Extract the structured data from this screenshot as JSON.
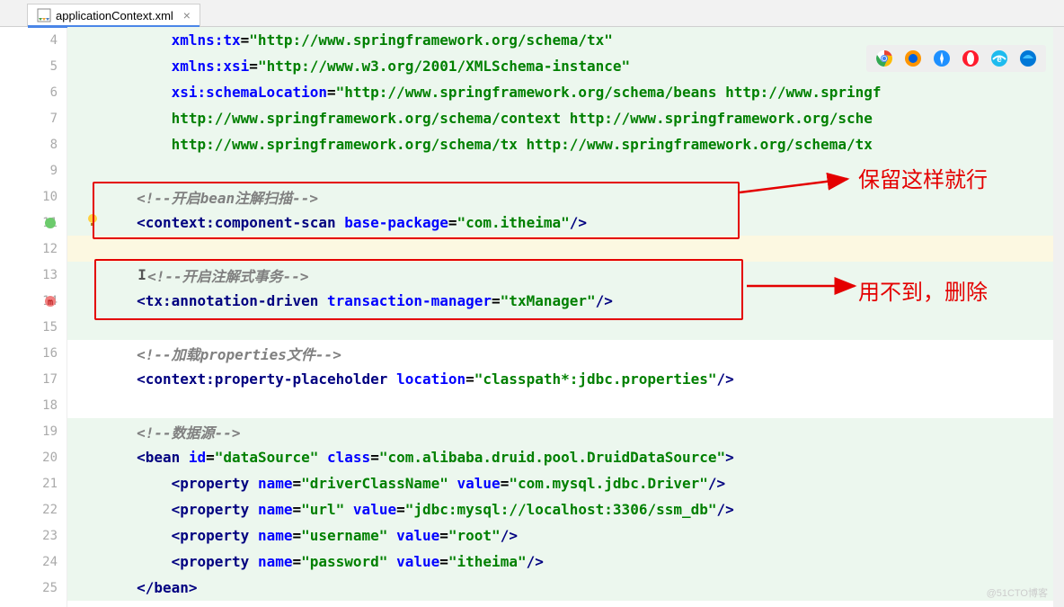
{
  "tab": {
    "filename": "applicationContext.xml"
  },
  "annotations": {
    "keep": "保留这样就行",
    "remove": "用不到，删除"
  },
  "watermark": "@51CTO博客",
  "lines": {
    "4": {
      "n": "4",
      "ind": "            ",
      "a": "xmlns:tx",
      "eq": "=",
      "v": "\"http://www.springframework.org/schema/tx\""
    },
    "5": {
      "n": "5",
      "ind": "            ",
      "a": "xmlns:xsi",
      "eq": "=",
      "v": "\"http://www.w3.org/2001/XMLSchema-instance\""
    },
    "6": {
      "n": "6",
      "ind": "            ",
      "a": "xsi:schemaLocation",
      "eq": "=",
      "v": "\"http://www.springframework.org/schema/beans http://www.springf"
    },
    "7": {
      "n": "7",
      "ind": "            ",
      "v": "http://www.springframework.org/schema/context http://www.springframework.org/sche"
    },
    "8": {
      "n": "8",
      "ind": "            ",
      "v": "http://www.springframework.org/schema/tx http://www.springframework.org/schema/tx"
    },
    "9": {
      "n": "9"
    },
    "10": {
      "n": "10",
      "ind": "        ",
      "c": "<!--开启bean注解扫描-->"
    },
    "11": {
      "n": "11",
      "ind": "        ",
      "o": "<",
      "t": "context:component-scan",
      "sp": " ",
      "a": "base-package",
      "eq": "=",
      "v": "\"com.itheima\"",
      "cl": "/>"
    },
    "12": {
      "n": "12"
    },
    "13": {
      "n": "13",
      "ind": "        ",
      "c": "<!--开启注解式事务-->"
    },
    "14": {
      "n": "14",
      "ind": "        ",
      "o": "<",
      "t": "tx:annotation-driven",
      "sp": " ",
      "a": "transaction-manager",
      "eq": "=",
      "v": "\"txManager\"",
      "cl": "/>"
    },
    "15": {
      "n": "15"
    },
    "16": {
      "n": "16",
      "ind": "        ",
      "c": "<!--加载properties文件-->"
    },
    "17": {
      "n": "17",
      "ind": "        ",
      "o": "<",
      "t": "context:property-placeholder",
      "sp": " ",
      "a": "location",
      "eq": "=",
      "v": "\"classpath*:jdbc.properties\"",
      "cl": "/>"
    },
    "18": {
      "n": "18"
    },
    "19": {
      "n": "19",
      "ind": "        ",
      "c": "<!--数据源-->"
    },
    "20": {
      "n": "20",
      "ind": "        ",
      "o": "<",
      "t": "bean",
      "sp": " ",
      "a": "id",
      "eq": "=",
      "v": "\"dataSource\"",
      "sp2": " ",
      "a2": "class",
      "eq2": "=",
      "v2": "\"com.alibaba.druid.pool.DruidDataSource\"",
      "cl": ">"
    },
    "21": {
      "n": "21",
      "ind": "            ",
      "o": "<",
      "t": "property",
      "sp": " ",
      "a": "name",
      "eq": "=",
      "v": "\"driverClassName\"",
      "sp2": " ",
      "a2": "value",
      "eq2": "=",
      "v2": "\"com.mysql.jdbc.Driver\"",
      "cl": "/>"
    },
    "22": {
      "n": "22",
      "ind": "            ",
      "o": "<",
      "t": "property",
      "sp": " ",
      "a": "name",
      "eq": "=",
      "v": "\"url\"",
      "sp2": " ",
      "a2": "value",
      "eq2": "=",
      "v2": "\"jdbc:mysql://localhost:3306/ssm_db\"",
      "cl": "/>"
    },
    "23": {
      "n": "23",
      "ind": "            ",
      "o": "<",
      "t": "property",
      "sp": " ",
      "a": "name",
      "eq": "=",
      "v": "\"username\"",
      "sp2": " ",
      "a2": "value",
      "eq2": "=",
      "v2": "\"root\"",
      "cl": "/>"
    },
    "24": {
      "n": "24",
      "ind": "            ",
      "o": "<",
      "t": "property",
      "sp": " ",
      "a": "name",
      "eq": "=",
      "v": "\"password\"",
      "sp2": " ",
      "a2": "value",
      "eq2": "=",
      "v2": "\"itheima\"",
      "cl": "/>"
    },
    "25": {
      "n": "25",
      "ind": "        ",
      "o": "</",
      "t": "bean",
      "cl": ">"
    }
  }
}
